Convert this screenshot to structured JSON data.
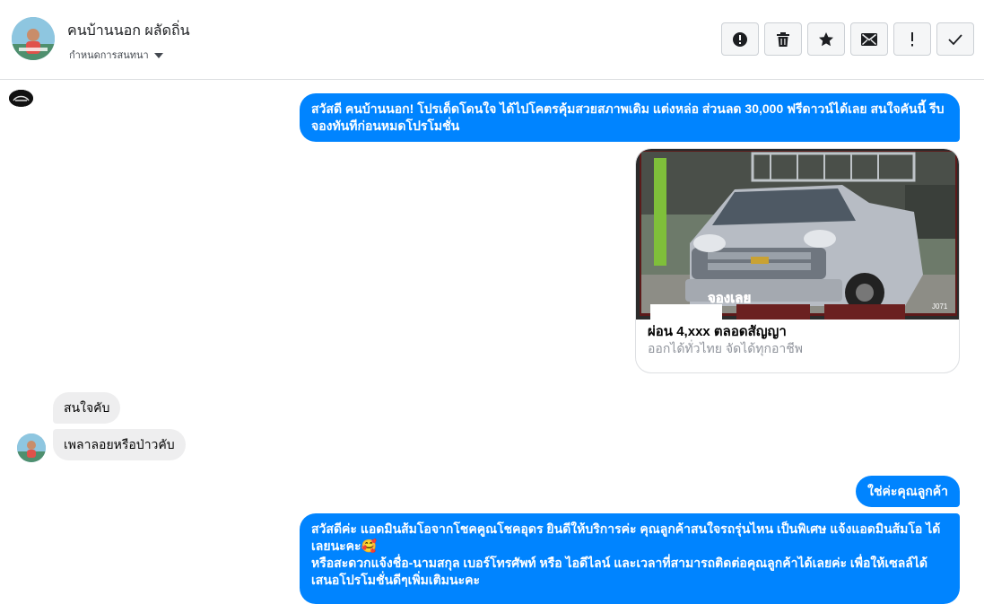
{
  "header": {
    "contact_name": "คนบ้านนอก ผลัดถิ่น",
    "assign_label": "กำหนดการสนทนา"
  },
  "toolbar": {
    "buttons": [
      {
        "icon": "alert-circle-icon"
      },
      {
        "icon": "trash-icon"
      },
      {
        "icon": "star-icon"
      },
      {
        "icon": "envelope-icon"
      },
      {
        "icon": "exclamation-icon"
      },
      {
        "icon": "checkmark-icon"
      }
    ]
  },
  "messages": {
    "outgoing_1": "สวัสดี คนบ้านนอก! โปรเด็ดโดนใจ ได้ไปโคตรคุ้มสวยสภาพเดิม แต่งหล่อ  ส่วนลด 30,000 ฟรีดาวน์ได้เลย สนใจคันนี้ รีบจองทันทีก่อนหมดโปรโมชั่น",
    "card": {
      "title": "ผ่อน 4,xxx ตลอดสัญญา",
      "subtitle": "ออกได้ทั่วไทย จัดได้ทุกอาชีพ",
      "image_badge": "จองเลย",
      "image_code": "J071"
    },
    "incoming_1": "สนใจคับ",
    "incoming_2": "เพลาลอยหรือป่าวคับ",
    "outgoing_2": "ใช่ค่ะคุณลูกค้า",
    "outgoing_3_line1": "สวัสดีค่ะ แอดมินส้มโอจากโชคคูณโชคอุดร ยินดีให้บริการค่ะ   คุณลูกค้าสนใจรถรุ่นไหน เป็นพิเศษ แจ้งแอดมินส้มโอ ได้เลยนะคะ🥰",
    "outgoing_3_line2": "หรือสะดวกแจ้งชื่อ-นามสกุล เบอร์โทรศัพท์ หรือ ไอดีไลน์ และเวลาที่สามารถติดต่อคุณลูกค้าได้เลยค่ะ เพื่อให้เซลล์ได้เสนอโปรโมชั่นดีๆเพิ่มเติมนะคะ"
  },
  "colors": {
    "outgoing_bubble": "#0084ff",
    "incoming_bubble": "#eeeeef",
    "divider": "#dddfe2"
  }
}
